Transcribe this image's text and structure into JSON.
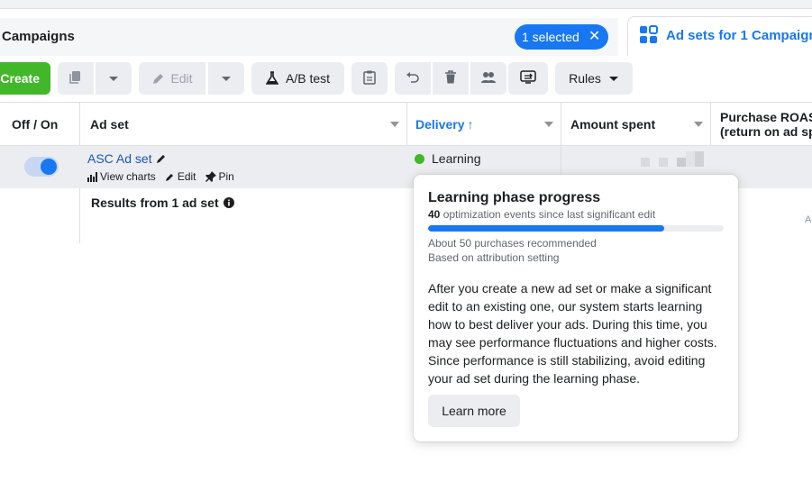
{
  "header": {
    "tab_title": "Campaigns",
    "selected_label": "1 selected",
    "adsets_tab_label": "Ad sets for 1 Campaign"
  },
  "toolbar": {
    "create_label": "Create",
    "edit_label": "Edit",
    "ab_test_label": "A/B test",
    "rules_label": "Rules"
  },
  "columns": {
    "off_on": "Off / On",
    "ad_set": "Ad set",
    "delivery": "Delivery",
    "delivery_sort": "↑",
    "amount_spent": "Amount spent",
    "purchase_roas_1": "Purchase ROAS",
    "purchase_roas_2": "(return on ad spend)"
  },
  "row": {
    "name": "ASC Ad set",
    "view_charts": "View charts",
    "edit": "Edit",
    "pin": "Pin",
    "delivery_status": "Learning",
    "toggle_on": true
  },
  "results_label": "Results from 1 ad set",
  "far_right_text": "A",
  "tooltip": {
    "title": "Learning phase progress",
    "events_count": "40",
    "events_text": " optimization events since last significant edit",
    "progress_fraction": 0.8,
    "note1": "About 50 purchases recommended",
    "note2": "Based on attribution setting",
    "body": "After you create a new ad set or make a significant edit to an existing one, our system starts learning how to best deliver your ads. During this time, you may see performance fluctuations and higher costs. Since performance is still stabilizing, avoid editing your ad set during the learning phase.",
    "button": "Learn more"
  },
  "colors": {
    "accent": "#1877f2",
    "create_green": "#42b72a",
    "status_green": "#42b72a"
  }
}
